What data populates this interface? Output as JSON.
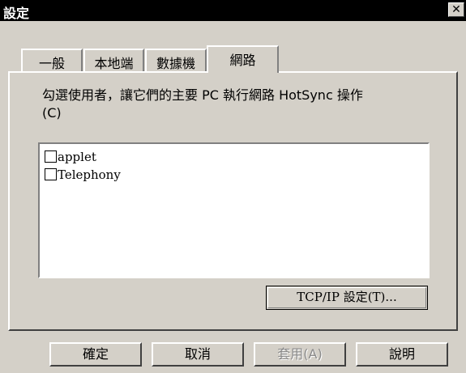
{
  "window": {
    "title": "設定",
    "close_label": "✕"
  },
  "tabs": [
    {
      "label": "一般"
    },
    {
      "label": "本地端"
    },
    {
      "label": "數據機"
    },
    {
      "label": "網路"
    }
  ],
  "active_tab": "網路",
  "network": {
    "description": "勾選使用者，讓它們的主要 PC 執行網路 HotSync 操作",
    "mnemonic": "(C)",
    "users": [
      {
        "label": "applet",
        "checked": false
      },
      {
        "label": "Telephony",
        "checked": false
      }
    ],
    "tcp_button": "TCP/IP 設定(T)..."
  },
  "buttons": {
    "ok": "確定",
    "cancel": "取消",
    "apply": "套用(A)",
    "help": "說明"
  }
}
